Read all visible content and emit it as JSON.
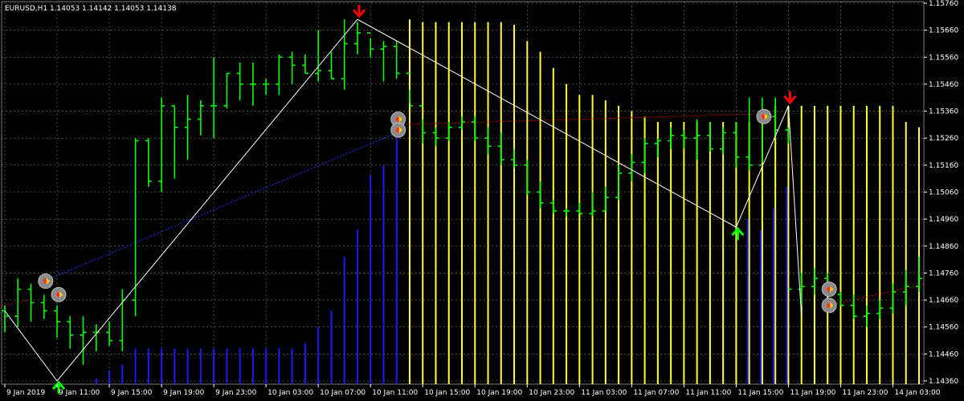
{
  "chart_data": {
    "type": "bar",
    "title": "EURUSD,H1  1.14053 1.14142 1.14053 1.14138",
    "ylim": [
      1.1436,
      1.1576
    ],
    "y_ticks": [
      "1.15760",
      "1.15660",
      "1.15560",
      "1.15460",
      "1.15360",
      "1.15260",
      "1.15160",
      "1.15060",
      "1.14960",
      "1.14860",
      "1.14760",
      "1.14660",
      "1.14560",
      "1.14460",
      "1.14360"
    ],
    "x_labels": [
      "9 Jan 2019",
      "9 Jan 11:00",
      "9 Jan 15:00",
      "9 Jan 19:00",
      "9 Jan 23:00",
      "10 Jan 03:00",
      "10 Jan 07:00",
      "10 Jan 11:00",
      "10 Jan 15:00",
      "10 Jan 19:00",
      "10 Jan 23:00",
      "11 Jan 03:00",
      "11 Jan 07:00",
      "11 Jan 11:00",
      "11 Jan 15:00",
      "11 Jan 19:00",
      "11 Jan 23:00",
      "14 Jan 03:00"
    ],
    "bar_count": 71,
    "colors": {
      "background": "#000000",
      "grid": "#7a7a7a",
      "bull_bar": "#00ff00",
      "bear_bar": "#00ff00",
      "histogram_yellow": "#ffff33",
      "histogram_blue": "#1a1aff",
      "zigzag": "#ffffff",
      "signal_dotted": "#cc0000",
      "up_arrow": "#00ff00",
      "down_arrow": "#ff0000"
    },
    "ohlc_series": {
      "name": "EURUSD H1",
      "open": [
        1.1462,
        1.146,
        1.147,
        1.1465,
        1.1462,
        1.1458,
        1.1453,
        1.1454,
        1.1454,
        1.1451,
        1.1466,
        1.1525,
        1.151,
        1.1538,
        1.153,
        1.1533,
        1.1538,
        1.1538,
        1.155,
        1.1546,
        1.1546,
        1.1546,
        1.1556,
        1.1553,
        1.155,
        1.1551,
        1.1548,
        1.1561,
        1.1565,
        1.1559,
        1.156,
        1.155,
        1.1538,
        1.1528,
        1.1526,
        1.153,
        1.1532,
        1.1526,
        1.1523,
        1.1518,
        1.1516,
        1.1506,
        1.1502,
        1.1499,
        1.1499,
        1.1498,
        1.1499,
        1.1504,
        1.1513,
        1.1517,
        1.1524,
        1.1525,
        1.1527,
        1.1526,
        1.1527,
        1.1522,
        1.1528,
        1.1519,
        1.1516,
        1.1534,
        1.1529,
        1.147,
        1.1471,
        1.1474,
        1.1468,
        1.1464,
        1.146,
        1.1461,
        1.1463,
        1.1469,
        1.1471
      ],
      "high": [
        1.1464,
        1.1474,
        1.1472,
        1.1468,
        1.1464,
        1.146,
        1.146,
        1.1457,
        1.1458,
        1.147,
        1.1526,
        1.1526,
        1.1541,
        1.1538,
        1.1542,
        1.154,
        1.1556,
        1.155,
        1.1554,
        1.1554,
        1.1548,
        1.1557,
        1.1558,
        1.1557,
        1.1566,
        1.1558,
        1.157,
        1.1569,
        1.1563,
        1.1562,
        1.1562,
        1.1544,
        1.1533,
        1.153,
        1.1532,
        1.1534,
        1.1534,
        1.153,
        1.1528,
        1.1522,
        1.1518,
        1.151,
        1.1503,
        1.15,
        1.1502,
        1.1506,
        1.1508,
        1.1516,
        1.152,
        1.1526,
        1.1526,
        1.153,
        1.1529,
        1.1533,
        1.1532,
        1.153,
        1.1532,
        1.1541,
        1.1541,
        1.1541,
        1.153,
        1.1476,
        1.1478,
        1.1476,
        1.1469,
        1.1468,
        1.1464,
        1.1466,
        1.1472,
        1.1477,
        1.1482
      ],
      "low": [
        1.1454,
        1.1456,
        1.1458,
        1.1459,
        1.1452,
        1.1448,
        1.1442,
        1.1447,
        1.1449,
        1.1447,
        1.146,
        1.1508,
        1.1506,
        1.1511,
        1.1518,
        1.1527,
        1.1526,
        1.1537,
        1.154,
        1.1538,
        1.1542,
        1.1542,
        1.1546,
        1.155,
        1.1547,
        1.1548,
        1.1544,
        1.1557,
        1.1556,
        1.1547,
        1.1548,
        1.1539,
        1.1524,
        1.1523,
        1.1525,
        1.1529,
        1.1525,
        1.152,
        1.1516,
        1.1515,
        1.1505,
        1.15,
        1.1498,
        1.1497,
        1.1498,
        1.1497,
        1.1499,
        1.1503,
        1.151,
        1.1513,
        1.1519,
        1.1522,
        1.1522,
        1.1518,
        1.1521,
        1.152,
        1.1515,
        1.1514,
        1.1517,
        1.1526,
        1.1524,
        1.1464,
        1.1468,
        1.147,
        1.1464,
        1.1459,
        1.1456,
        1.1459,
        1.1461,
        1.1464,
        1.1469
      ],
      "close": [
        1.146,
        1.147,
        1.1465,
        1.1462,
        1.1458,
        1.1453,
        1.1454,
        1.1454,
        1.1451,
        1.1466,
        1.1525,
        1.151,
        1.1538,
        1.153,
        1.1533,
        1.1538,
        1.1538,
        1.155,
        1.1546,
        1.1546,
        1.1546,
        1.1556,
        1.1553,
        1.155,
        1.1551,
        1.1548,
        1.1561,
        1.1565,
        1.1559,
        1.156,
        1.155,
        1.1538,
        1.1528,
        1.1526,
        1.153,
        1.1532,
        1.1526,
        1.1523,
        1.1518,
        1.1516,
        1.1506,
        1.1502,
        1.1499,
        1.1499,
        1.1498,
        1.1499,
        1.1504,
        1.1513,
        1.1517,
        1.1524,
        1.1525,
        1.1527,
        1.1526,
        1.1527,
        1.1522,
        1.1528,
        1.1519,
        1.1516,
        1.1534,
        1.1529,
        1.147,
        1.1471,
        1.1474,
        1.1468,
        1.1464,
        1.146,
        1.1461,
        1.1463,
        1.1469,
        1.1471,
        1.1474
      ]
    },
    "histogram_series": {
      "name": "",
      "yellow_bar_indices_start": 31,
      "yellow_bar_indices_end": 70,
      "yellow_heights": [
        1.157,
        1.1569,
        1.1569,
        1.1569,
        1.1569,
        1.1569,
        1.1569,
        1.1569,
        1.1568,
        1.1562,
        1.1558,
        1.1552,
        1.1546,
        1.1542,
        1.1542,
        1.154,
        1.1538,
        1.1536,
        1.1534,
        1.1532,
        1.1532,
        1.1532,
        1.1532,
        1.1532,
        1.1532,
        1.1532,
        1.1532,
        1.1532,
        1.1538,
        1.1538,
        1.1538,
        1.1538,
        1.1538,
        1.1538,
        1.1538,
        1.1538,
        1.1538,
        1.1538,
        1.1532,
        1.153
      ],
      "blue_bar_values": [
        1.1436,
        1.1436,
        1.1436,
        1.1436,
        1.1436,
        1.1436,
        1.1436,
        1.1437,
        1.144,
        1.1442,
        1.1448,
        1.1448,
        1.1448,
        1.1448,
        1.1448,
        1.1448,
        1.1448,
        1.1448,
        1.1448,
        1.1448,
        1.1448,
        1.1448,
        1.1448,
        1.145,
        1.1456,
        1.1462,
        1.1482,
        1.1492,
        1.1512,
        1.1516,
        1.1526
      ],
      "blue_right_indices_start": 57,
      "blue_right_values": [
        1.1496,
        1.1492,
        1.15,
        1.1508
      ]
    },
    "zigzag": [
      [
        0,
        1.1462
      ],
      [
        4,
        1.1436
      ],
      [
        27,
        1.157
      ],
      [
        56,
        1.1493
      ],
      [
        60,
        1.1538
      ],
      [
        61,
        1.146
      ]
    ],
    "arrows": {
      "down": [
        27,
        60
      ],
      "up": [
        4,
        56
      ]
    },
    "signal_markers": [
      [
        3,
        1.1473
      ],
      [
        4,
        1.1468
      ],
      [
        30,
        1.1533
      ],
      [
        30,
        1.1529
      ],
      [
        58,
        1.1534
      ],
      [
        63,
        1.147
      ],
      [
        63,
        1.1464
      ]
    ]
  }
}
